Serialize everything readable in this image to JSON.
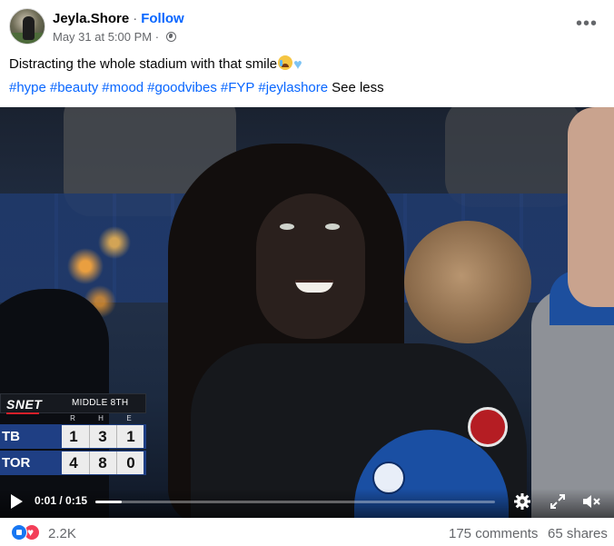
{
  "post": {
    "author": "Jeyla.Shore",
    "separator": "·",
    "follow_label": "Follow",
    "timestamp": "May 31 at 5:00 PM",
    "meta_separator": "·",
    "audience_icon": "globe-icon",
    "more_icon": "more-options-icon",
    "caption": "Distracting the whole stadium with that smile",
    "caption_emojis": [
      "crying-face-emoji",
      "blue-heart-emoji"
    ],
    "hashtags": [
      "#hype",
      "#beauty",
      "#mood",
      "#goodvibes",
      "#FYP",
      "#jeylashore"
    ],
    "see_less_label": "See less"
  },
  "scoreboard": {
    "network": "SNET",
    "inning": "MIDDLE 8TH",
    "headers": [
      "R",
      "H",
      "E"
    ],
    "rows": [
      {
        "team": "TB",
        "values": [
          "1",
          "3",
          "1"
        ]
      },
      {
        "team": "TOR",
        "values": [
          "4",
          "8",
          "0"
        ]
      }
    ]
  },
  "video_controls": {
    "play_icon": "play-icon",
    "time": "0:01 / 0:15",
    "progress_fraction": 0.067,
    "settings_icon": "gear-icon",
    "fullscreen_icon": "expand-icon",
    "mute_icon": "volume-muted-icon"
  },
  "footer": {
    "reaction_icons": [
      "like-icon",
      "love-icon"
    ],
    "reaction_count": "2.2K",
    "comments_label": "175 comments",
    "shares_label": "65 shares"
  },
  "colors": {
    "link_blue": "#0866ff",
    "secondary_text": "#65676b",
    "scorebug_blue": "#1f3f84",
    "like_blue": "#1877f2",
    "love_red": "#f33e58"
  }
}
